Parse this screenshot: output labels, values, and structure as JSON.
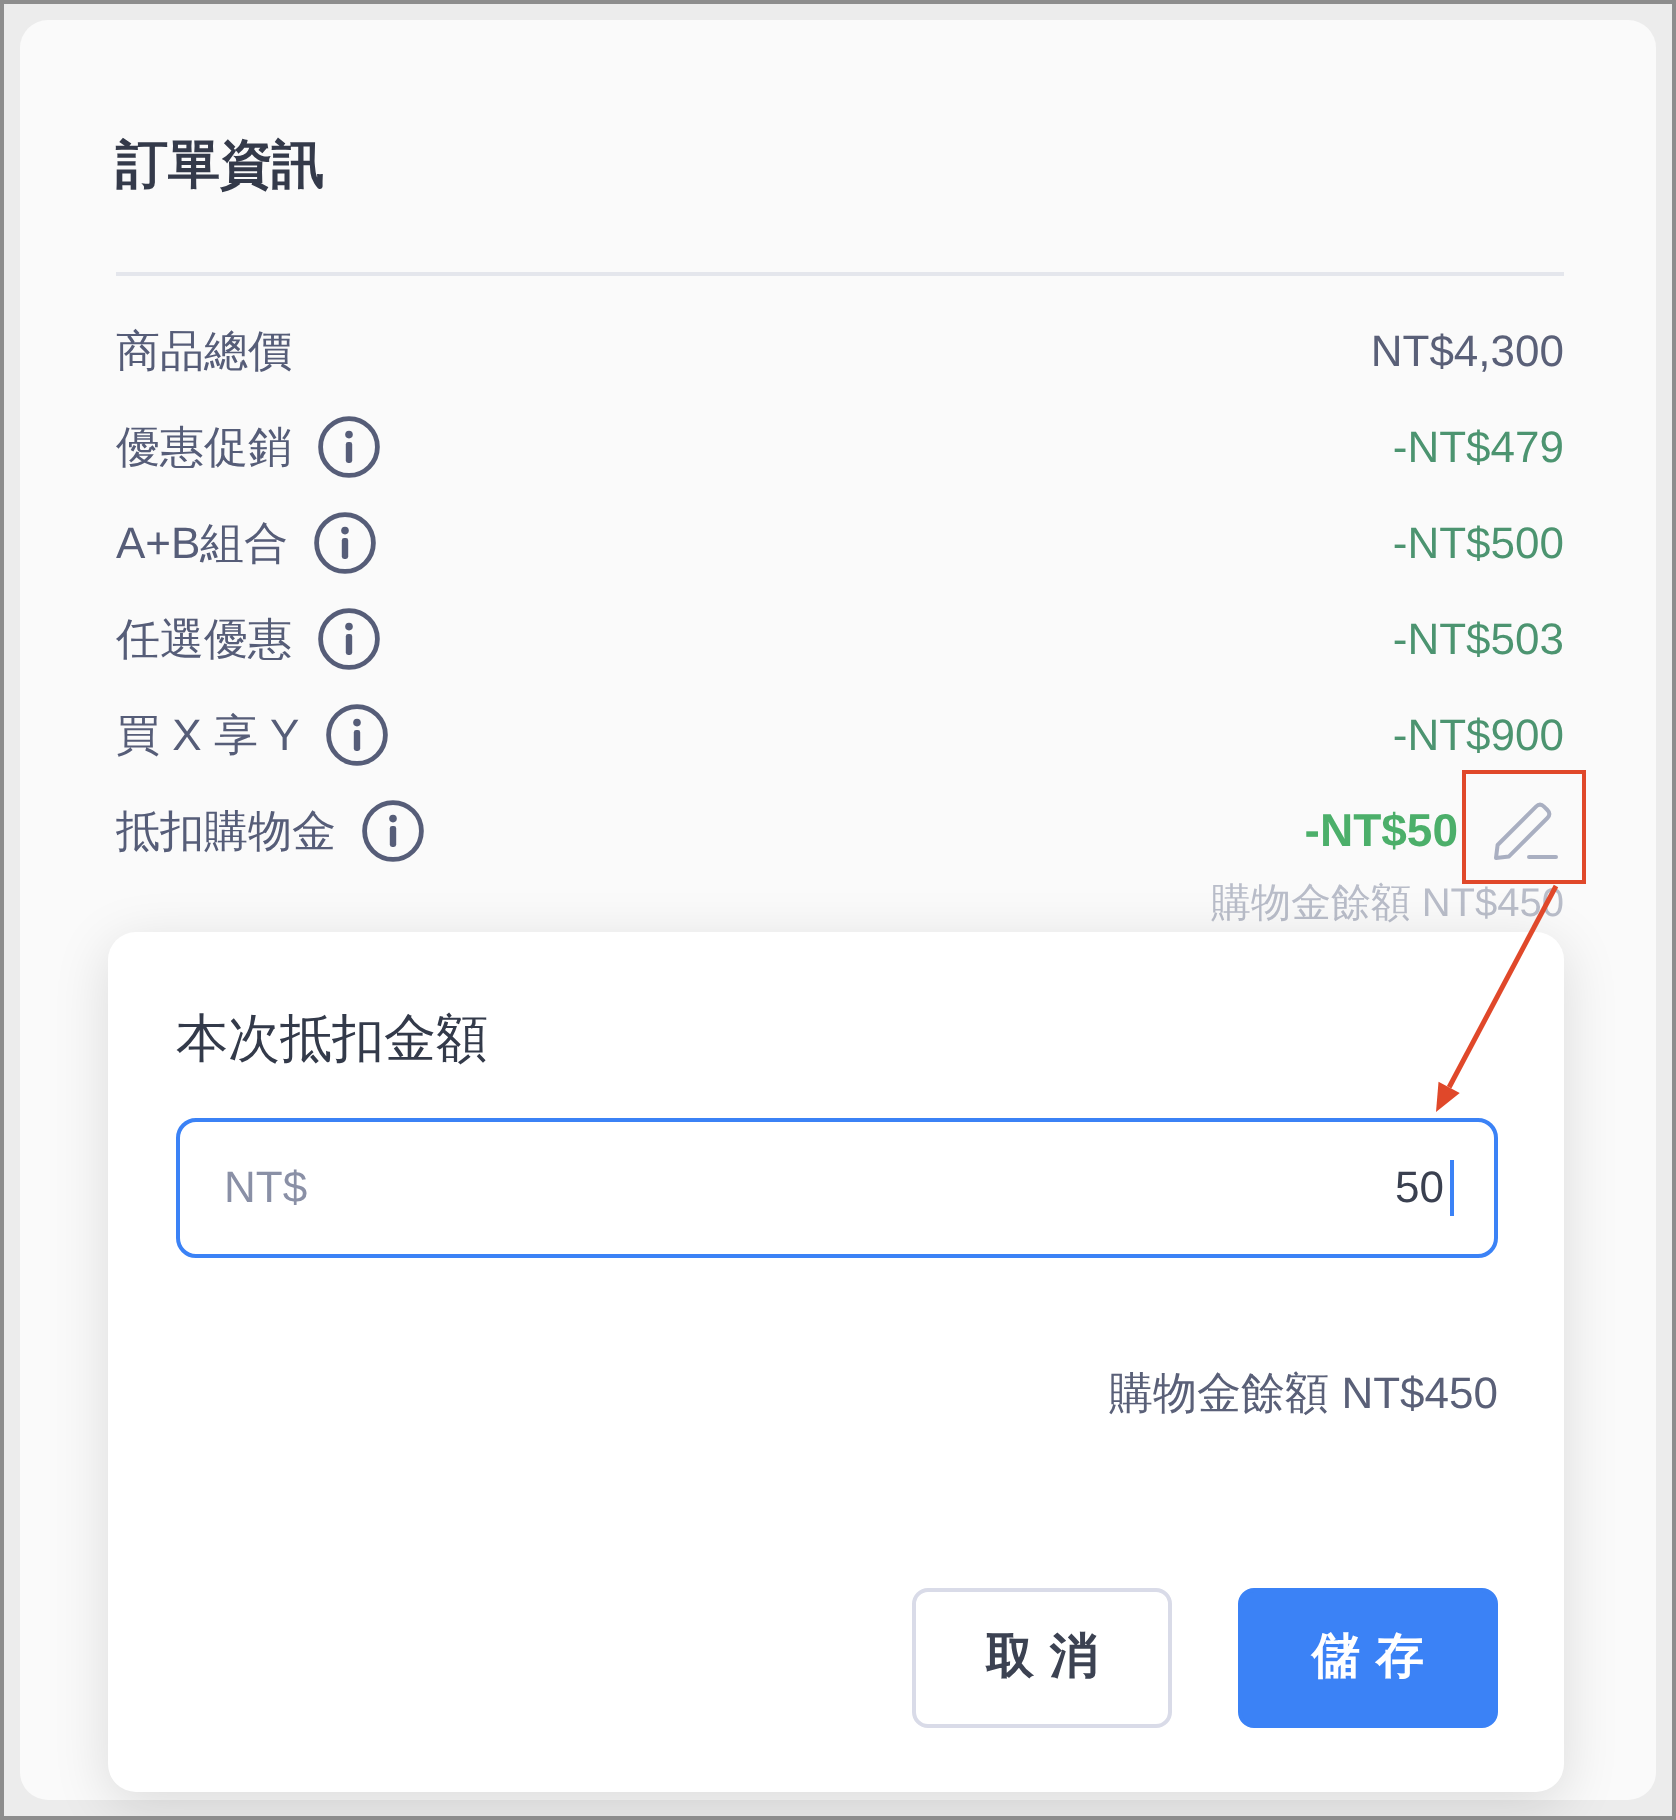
{
  "panel": {
    "title": "訂單資訊",
    "rows": [
      {
        "kind": "subtotal",
        "label": "商品總價",
        "value": "NT$4,300"
      },
      {
        "kind": "discount",
        "label": "優惠促銷",
        "value": "-NT$479"
      },
      {
        "kind": "discount",
        "label": "A+B組合",
        "value": "-NT$500"
      },
      {
        "kind": "discount",
        "label": "任選優惠",
        "value": "-NT$503"
      },
      {
        "kind": "discount",
        "label": "買 X 享 Y",
        "value": "-NT$900"
      },
      {
        "kind": "credit",
        "label": "抵扣購物金",
        "value": "-NT$50",
        "note": "購物金餘額 NT$450",
        "highlighted": true
      }
    ]
  },
  "dialog": {
    "title": "本次抵扣金額",
    "field": {
      "prefix": "NT$",
      "value": "50",
      "focused": true
    },
    "balance": "購物金餘額 NT$450",
    "buttons": [
      {
        "kind": "secondary",
        "label": "取消"
      },
      {
        "kind": "primary",
        "label": "儲存"
      }
    ]
  }
}
